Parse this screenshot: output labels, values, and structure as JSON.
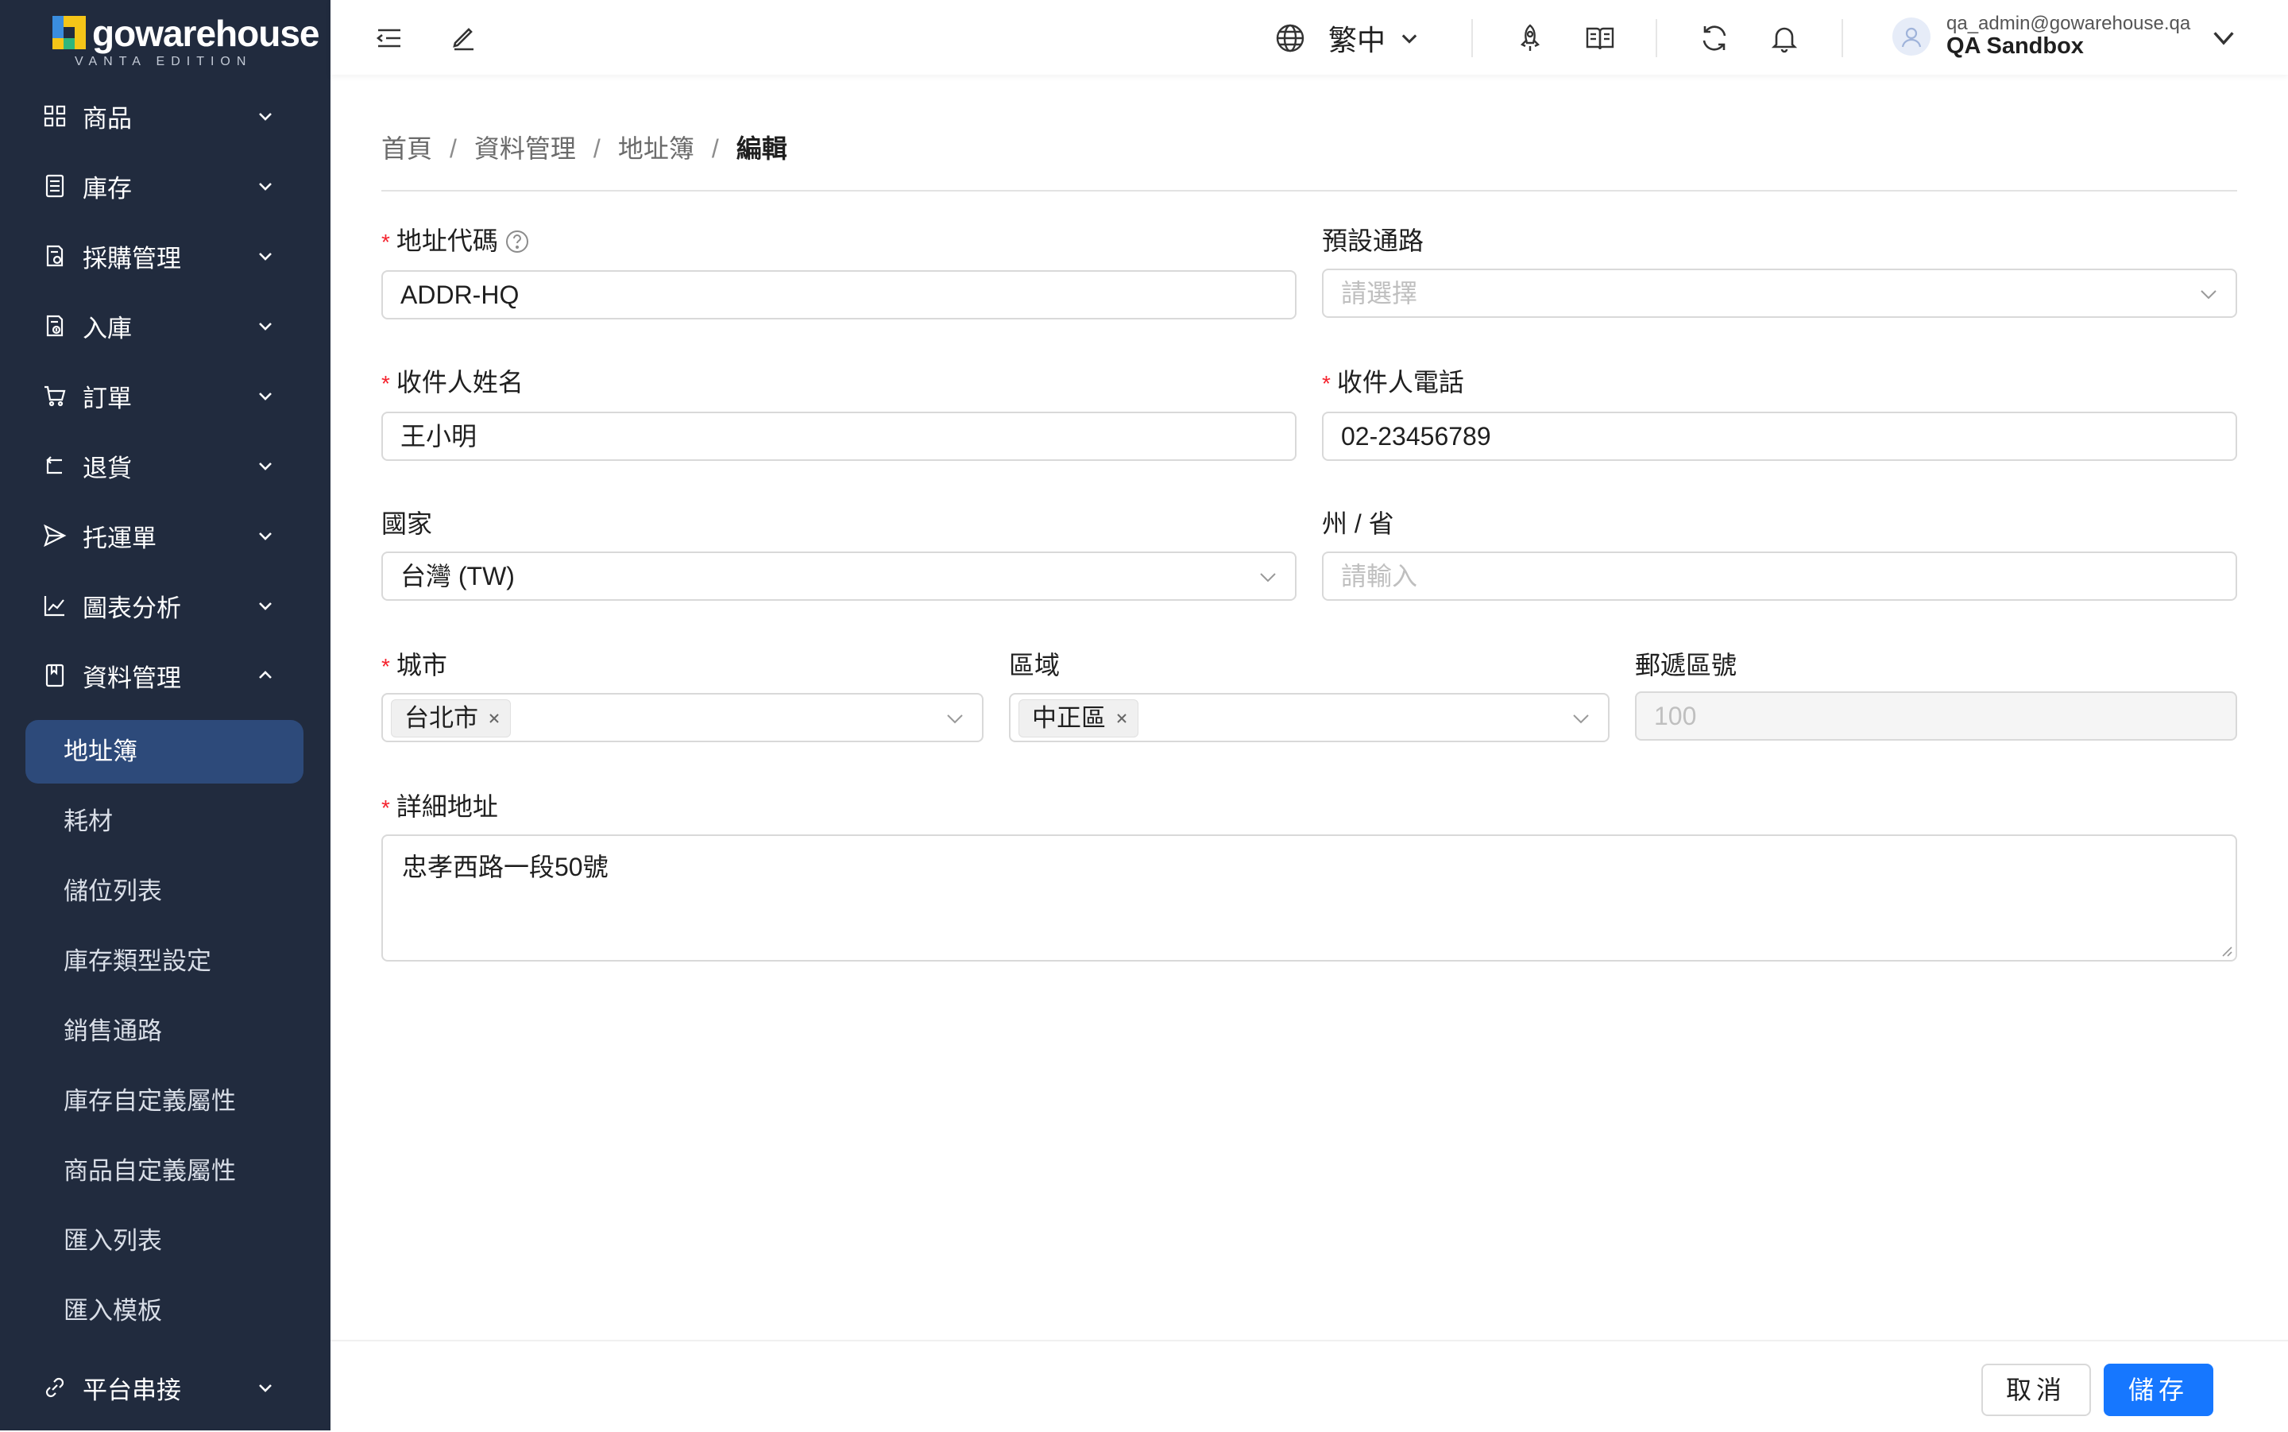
{
  "app": {
    "logo_text": "gowarehouse",
    "logo_subtitle": "VANTA EDITION"
  },
  "sidebar": {
    "items": [
      {
        "label": "商品",
        "icon": "grid-icon",
        "expanded": false
      },
      {
        "label": "庫存",
        "icon": "ledger-icon",
        "expanded": false
      },
      {
        "label": "採購管理",
        "icon": "purchase-doc-icon",
        "expanded": false
      },
      {
        "label": "入庫",
        "icon": "inbound-doc-icon",
        "expanded": false
      },
      {
        "label": "訂單",
        "icon": "cart-icon",
        "expanded": false
      },
      {
        "label": "退貨",
        "icon": "return-icon",
        "expanded": false
      },
      {
        "label": "托運單",
        "icon": "send-icon",
        "expanded": false
      },
      {
        "label": "圖表分析",
        "icon": "line-chart-icon",
        "expanded": false
      },
      {
        "label": "資料管理",
        "icon": "book-icon",
        "expanded": true
      },
      {
        "label": "平台串接",
        "icon": "link-icon",
        "expanded": false
      }
    ],
    "sub_items": [
      {
        "label": "地址簿",
        "active": true
      },
      {
        "label": "耗材",
        "active": false
      },
      {
        "label": "儲位列表",
        "active": false
      },
      {
        "label": "庫存類型設定",
        "active": false
      },
      {
        "label": "銷售通路",
        "active": false
      },
      {
        "label": "庫存自定義屬性",
        "active": false
      },
      {
        "label": "商品自定義屬性",
        "active": false
      },
      {
        "label": "匯入列表",
        "active": false
      },
      {
        "label": "匯入模板",
        "active": false
      }
    ]
  },
  "header": {
    "language": "繁中",
    "user_email": "qa_admin@gowarehouse.qa",
    "user_org": "QA Sandbox"
  },
  "breadcrumb": {
    "items": [
      "首頁",
      "資料管理",
      "地址簿"
    ],
    "separator": "/",
    "current": "編輯"
  },
  "form": {
    "address_code": {
      "label": "地址代碼",
      "required": true,
      "value": "ADDR-HQ"
    },
    "default_channel": {
      "label": "預設通路",
      "required": false,
      "value": "",
      "placeholder": "請選擇"
    },
    "recipient_name": {
      "label": "收件人姓名",
      "required": true,
      "value": "王小明"
    },
    "recipient_phone": {
      "label": "收件人電話",
      "required": true,
      "value": "02-23456789"
    },
    "country": {
      "label": "國家",
      "required": false,
      "value": "台灣 (TW)"
    },
    "state": {
      "label": "州 / 省",
      "required": false,
      "value": "",
      "placeholder": "請輸入"
    },
    "city": {
      "label": "城市",
      "required": true,
      "value": "台北市"
    },
    "district": {
      "label": "區域",
      "required": false,
      "value": "中正區"
    },
    "postal_code": {
      "label": "郵遞區號",
      "required": false,
      "value": "",
      "placeholder": "100",
      "disabled": true
    },
    "detail_address": {
      "label": "詳細地址",
      "required": true,
      "value": "忠孝西路一段50號"
    }
  },
  "footer": {
    "cancel_label": "取消",
    "save_label": "儲存"
  },
  "colors": {
    "sidebar_bg": "#212b3e",
    "active_item_bg": "#2d4a7a",
    "primary": "#1677ff",
    "required_mark": "#f5222d"
  }
}
